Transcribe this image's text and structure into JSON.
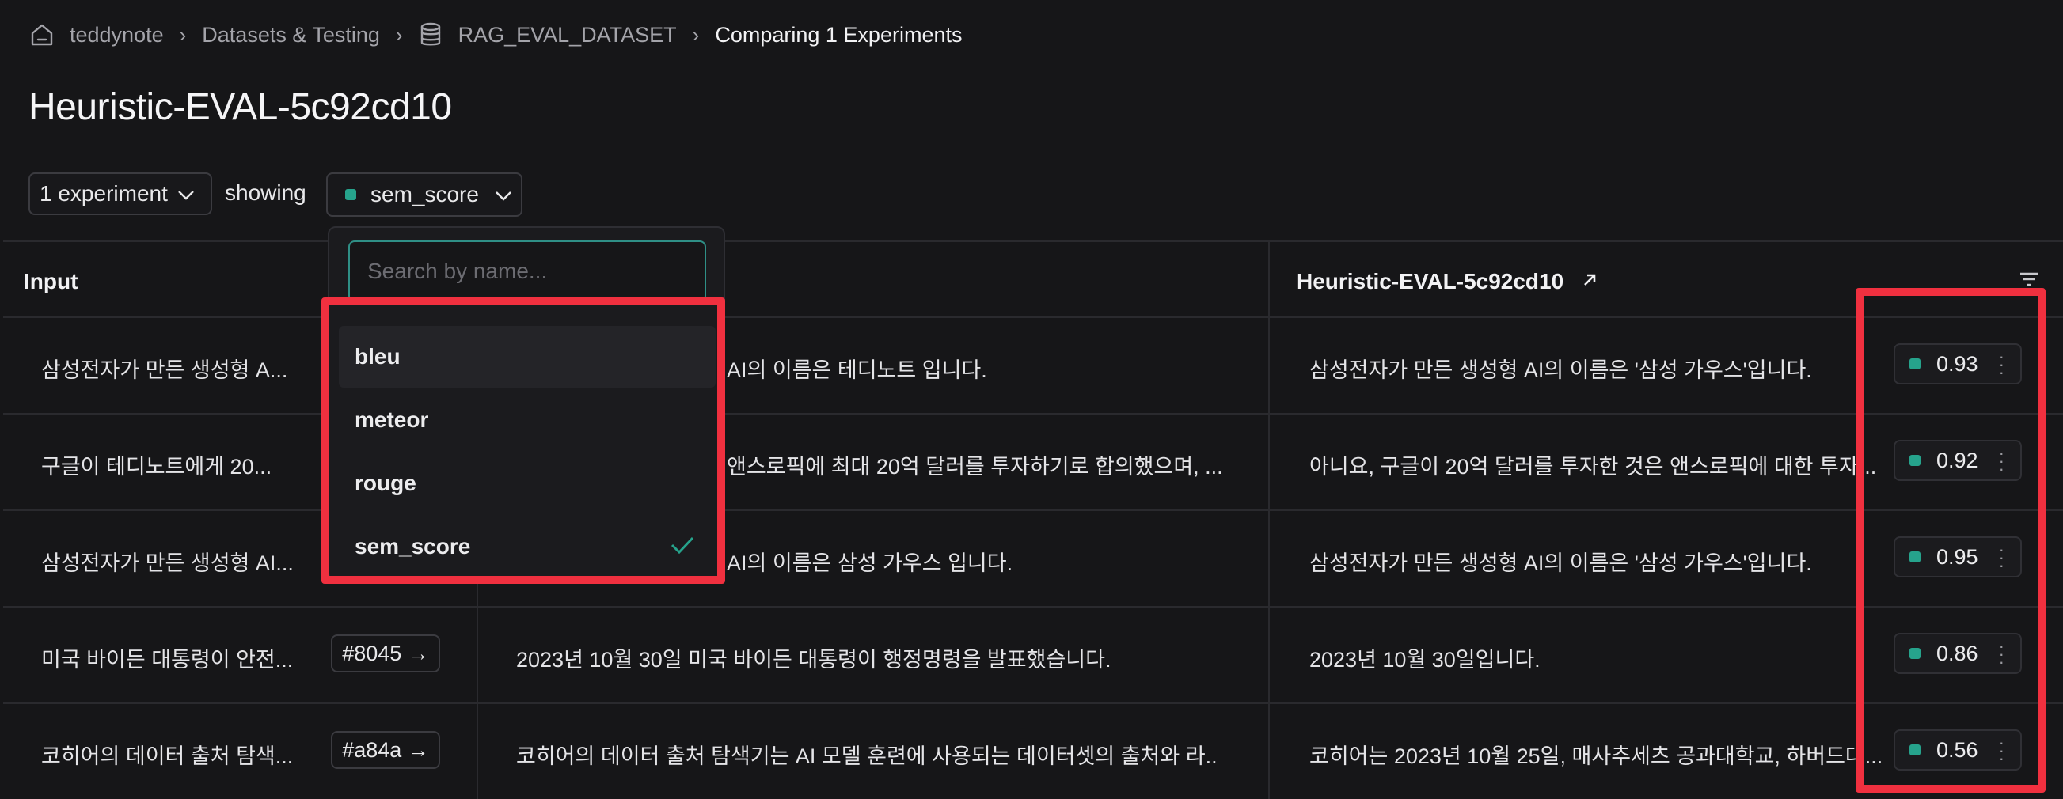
{
  "breadcrumb": {
    "home": "teddynote",
    "datasets": "Datasets & Testing",
    "dataset": "RAG_EVAL_DATASET",
    "current": "Comparing 1 Experiments"
  },
  "page_title": "Heuristic-EVAL-5c92cd10",
  "toolbar": {
    "experiment_select": "1 experiment",
    "showing_label": "showing",
    "metric_select": "sem_score"
  },
  "colors": {
    "accent": "#26a38c",
    "highlight_border": "#f0303f"
  },
  "table": {
    "col_input": "Input",
    "col_experiment": "Heuristic-EVAL-5c92cd10",
    "rows": [
      {
        "input": "삼성전자가 만든 생성형 A...",
        "tag": "",
        "reference": "AI의 이름은 테디노트 입니다.",
        "output": "삼성전자가 만든 생성형 AI의 이름은 '삼성 가우스'입니다.",
        "score": "0.93"
      },
      {
        "input": "구글이 테디노트에게 20...",
        "tag": "",
        "reference": "앤스로픽에 최대 20억 달러를 투자하기로 합의했으며, ...",
        "output": "아니요, 구글이 20억 달러를 투자한 것은 앤스로픽에 대한 투자...",
        "score": "0.92"
      },
      {
        "input": "삼성전자가 만든 생성형 AI...",
        "tag": "",
        "reference": "AI의 이름은 삼성 가우스 입니다.",
        "output": "삼성전자가 만든 생성형 AI의 이름은 '삼성 가우스'입니다.",
        "score": "0.95"
      },
      {
        "input": "미국 바이든 대통령이 안전...",
        "tag": "#8045 →",
        "reference": "2023년 10월 30일 미국 바이든 대통령이 행정명령을 발표했습니다.",
        "output": "2023년 10월 30일입니다.",
        "score": "0.86"
      },
      {
        "input": "코히어의 데이터 출처 탐색...",
        "tag": "#a84a →",
        "reference": "코히어의 데이터 출처 탐색기는 AI 모델 훈련에 사용되는 데이터셋의 출처와 라...",
        "output": "코히어는 2023년 10월 25일, 매사추세츠 공과대학교, 하버드대...",
        "score": "0.56"
      }
    ]
  },
  "metric_dropdown": {
    "search_placeholder": "Search by name...",
    "options": [
      "bleu",
      "meteor",
      "rouge",
      "sem_score"
    ],
    "selected": "sem_score"
  }
}
